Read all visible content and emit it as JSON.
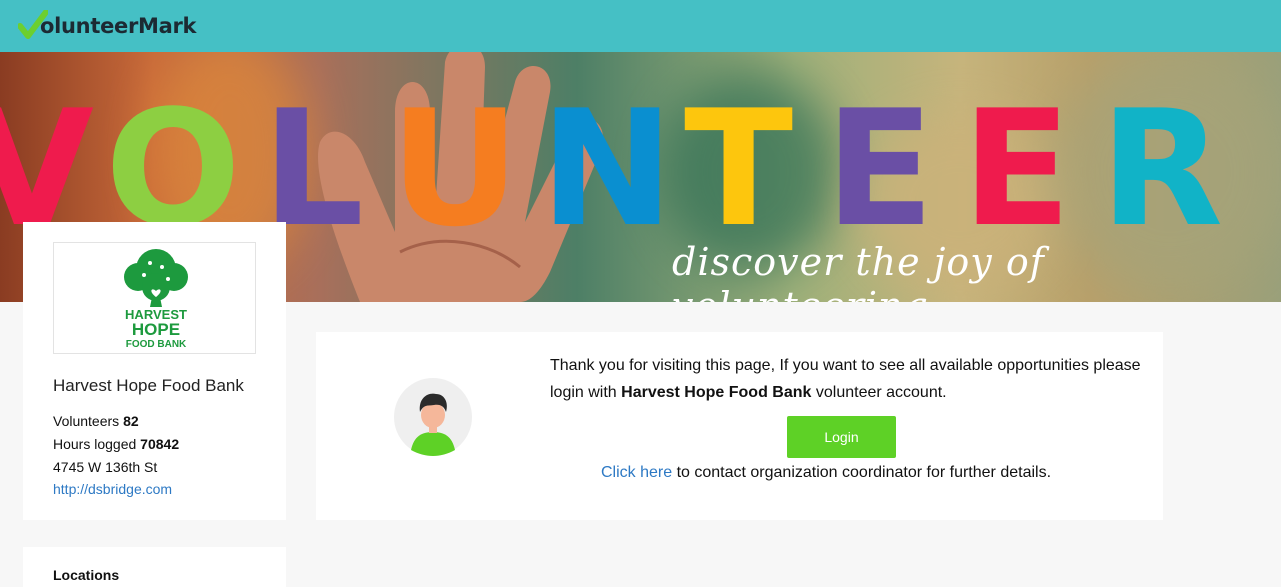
{
  "header": {
    "brand_text": "olunteerMark",
    "brand_icon": "checkmark-icon",
    "background_color": "#45c0c5"
  },
  "banner": {
    "letters": [
      "V",
      "O",
      "L",
      "U",
      "N",
      "T",
      "E",
      "E",
      "R"
    ],
    "letter_colors": [
      "#ef1b4d",
      "#8dcf42",
      "#6a4fa5",
      "#f57d20",
      "#0a8fd0",
      "#fdc60d",
      "#6a4fa5",
      "#ef1b4d",
      "#11b3c7"
    ],
    "tagline": "discover the joy of volunteering"
  },
  "organization": {
    "logo_text_line1": "HARVEST",
    "logo_text_line2": "HOPE",
    "logo_text_line3": "FOOD BANK",
    "name": "Harvest Hope Food Bank",
    "volunteers_label": "Volunteers",
    "volunteers_value": "82",
    "hours_label": "Hours logged",
    "hours_value": "70842",
    "address": "4745 W 136th St",
    "website": "http://dsbridge.com"
  },
  "second_card": {
    "label": "Locations"
  },
  "main": {
    "message_part1": "Thank you for visiting this page, If you want to see all available opportunities please login with ",
    "message_org": "Harvest Hope Food Bank",
    "message_part2": " volunteer account.",
    "login_label": "Login",
    "contact_link": "Click here",
    "contact_text": " to contact organization coordinator for further details.",
    "accent_color": "#5ed126",
    "link_color": "#2d79c4"
  }
}
